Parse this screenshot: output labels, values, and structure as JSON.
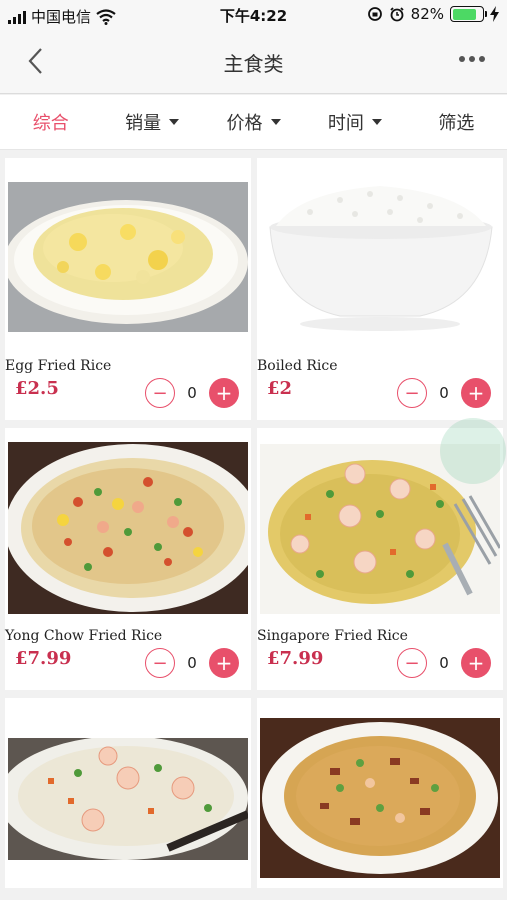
{
  "status_bar": {
    "carrier": "中国电信",
    "time": "下午4:22",
    "battery_percent": "82%",
    "battery_level": 0.82
  },
  "nav": {
    "title": "主食类"
  },
  "filters": [
    {
      "label": "综合",
      "active": true
    },
    {
      "label": "销量",
      "has_caret": true
    },
    {
      "label": "价格",
      "has_caret": true
    },
    {
      "label": "时间",
      "has_caret": true
    },
    {
      "label": "筛选"
    }
  ],
  "products": [
    {
      "name": "Egg Fried Rice",
      "price": "£2.5",
      "qty": "0",
      "image": "egg-fried-rice-photo"
    },
    {
      "name": "Boiled Rice",
      "price": "£2",
      "qty": "0",
      "image": "boiled-rice-photo"
    },
    {
      "name": "Yong Chow Fried Rice",
      "price": "£7.99",
      "qty": "0",
      "image": "yong-chow-fried-rice-photo"
    },
    {
      "name": "Singapore Fried Rice",
      "price": "£7.99",
      "qty": "0",
      "image": "singapore-fried-rice-photo"
    },
    {
      "image": "shrimp-fried-rice-photo"
    },
    {
      "image": "mixed-fried-rice-photo"
    }
  ],
  "colors": {
    "accent": "#e8506b",
    "price": "#c9304f"
  }
}
